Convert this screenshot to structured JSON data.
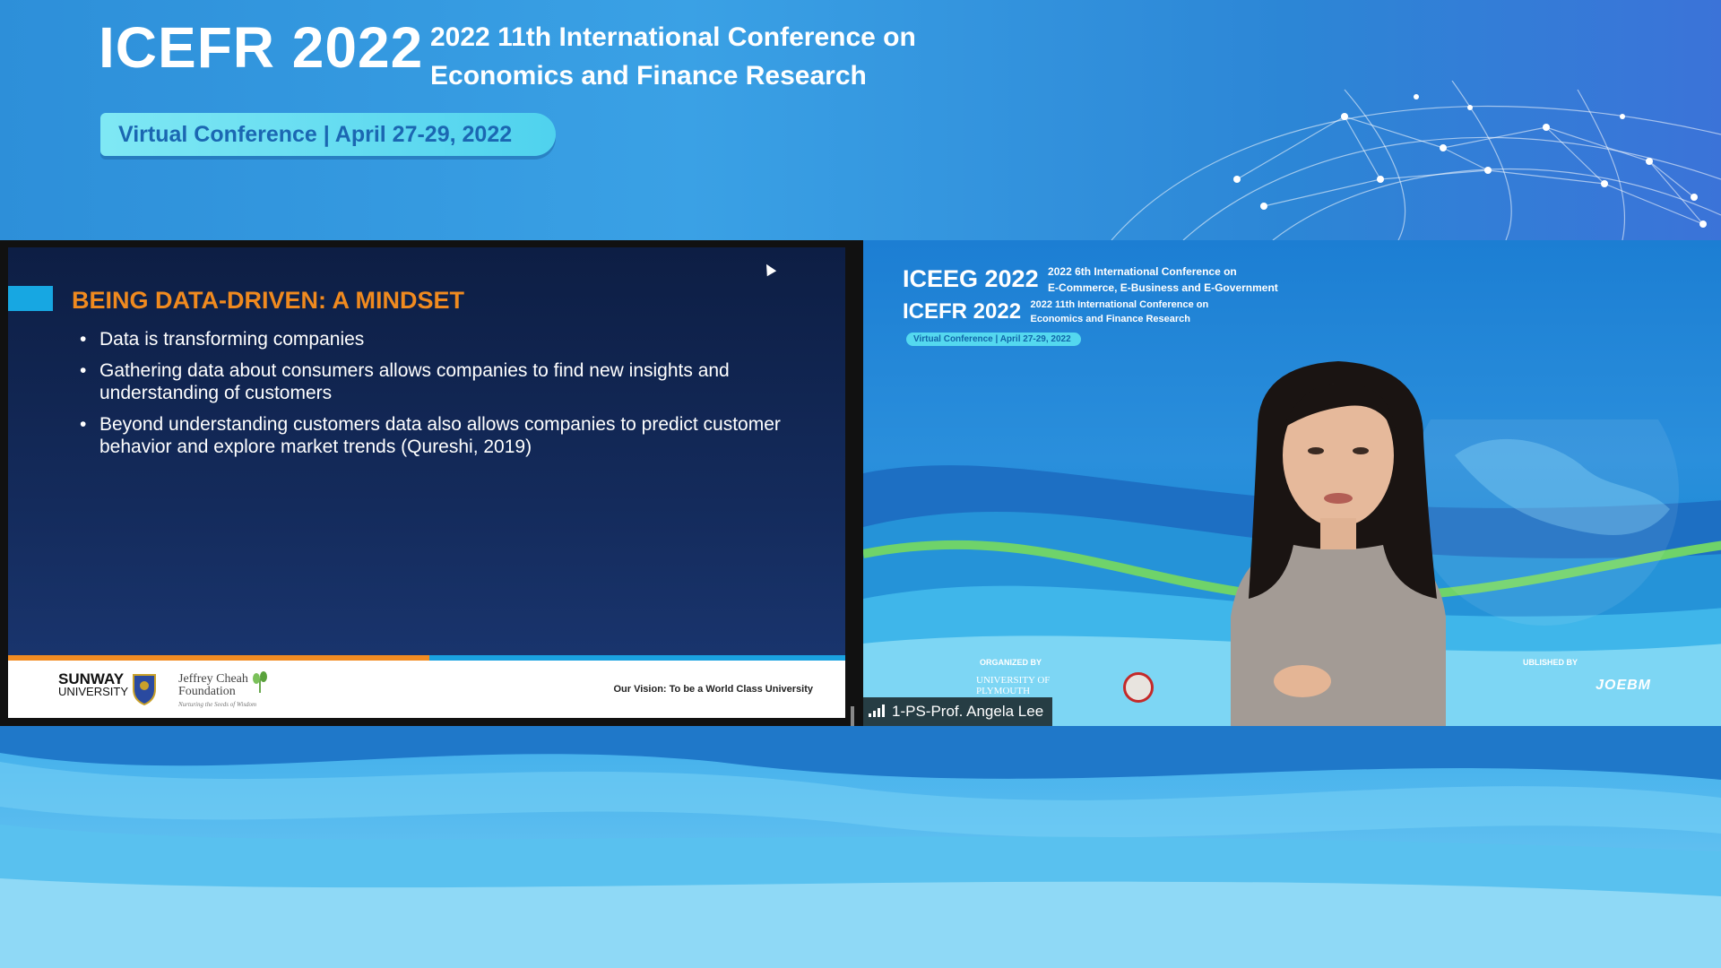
{
  "banner": {
    "title": "ICEFR 2022",
    "subtitle_line1": "2022 11th International Conference on",
    "subtitle_line2": "Economics and Finance Research",
    "pill": "Virtual Conference | April 27-29, 2022"
  },
  "slide": {
    "title": "BEING DATA-DRIVEN: A MINDSET",
    "bullets": [
      "Data is transforming companies",
      "Gathering data about consumers allows companies to find new insights and understanding of customers",
      "Beyond understanding customers data also allows companies to predict customer behavior and explore market trends (Qureshi, 2019)"
    ],
    "footer": {
      "sunway": "SUNWAY",
      "university": "UNIVERSITY",
      "jc_line1": "Jeffrey Cheah",
      "jc_line2": "Foundation",
      "jc_tagline": "Nurturing the Seeds of Wisdom",
      "vision": "Our Vision: To be a World Class University"
    }
  },
  "video": {
    "iceeg_title": "ICEEG 2022",
    "iceeg_sub1": "2022 6th International Conference on",
    "iceeg_sub2": "E-Commerce, E-Business and E-Government",
    "icefr_title": "ICEFR 2022",
    "icefr_sub1": "2022 11th International Conference on",
    "icefr_sub2": "Economics and Finance Research",
    "pill": "Virtual Conference | April 27-29, 2022",
    "organized_by": "ORGANIZED BY",
    "published_by": "UBLISHED BY",
    "plymouth_line1": "UNIVERSITY OF",
    "plymouth_line2": "PLYMOUTH",
    "pub_logo": "JOEBM",
    "participant_name": "1-PS-Prof. Angela Lee"
  },
  "colors": {
    "accent_orange": "#f08a1f",
    "slide_bg": "#142b5c",
    "banner_blue": "#2d8fd9"
  }
}
